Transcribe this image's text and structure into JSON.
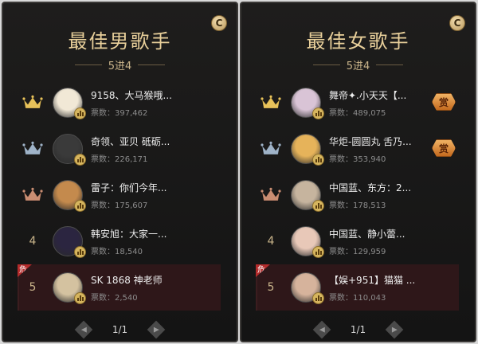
{
  "panels": [
    {
      "title": "最佳男歌手",
      "subtitle": "5进4",
      "page": "1/1",
      "rows": [
        {
          "rank": "",
          "crown": "gold",
          "name": "9158、大马猴哦...",
          "votes": "票数：397,462",
          "danger": false,
          "reward": false
        },
        {
          "rank": "",
          "crown": "silver",
          "name": "奇领、亚贝 砥砺...",
          "votes": "票数：226,171",
          "danger": false,
          "reward": false
        },
        {
          "rank": "",
          "crown": "bronze",
          "name": "雷子：你们今年...",
          "votes": "票数：175,607",
          "danger": false,
          "reward": false
        },
        {
          "rank": "4",
          "crown": "",
          "name": "韩安旭：大家一...",
          "votes": "票数：18,540",
          "danger": false,
          "reward": false
        },
        {
          "rank": "5",
          "crown": "",
          "name": "SK 1868 神老师",
          "votes": "票数：2,540",
          "danger": true,
          "reward": false
        }
      ]
    },
    {
      "title": "最佳女歌手",
      "subtitle": "5进4",
      "page": "1/1",
      "rows": [
        {
          "rank": "",
          "crown": "gold",
          "name": "舞帝✦.小天天【...",
          "votes": "票数：489,075",
          "danger": false,
          "reward": true
        },
        {
          "rank": "",
          "crown": "silver",
          "name": "华炬-圆圆丸 舌乃...",
          "votes": "票数：353,940",
          "danger": false,
          "reward": true
        },
        {
          "rank": "",
          "crown": "bronze",
          "name": "中国蓝、东方：2...",
          "votes": "票数：178,513",
          "danger": false,
          "reward": false
        },
        {
          "rank": "4",
          "crown": "",
          "name": "中国蓝、静小蕾...",
          "votes": "票数：129,959",
          "danger": false,
          "reward": false
        },
        {
          "rank": "5",
          "crown": "",
          "name": "【娱+951】猫猫 ...",
          "votes": "票数：110,043",
          "danger": true,
          "reward": false
        }
      ]
    }
  ],
  "labels": {
    "corner_badge": "C",
    "danger_tag": "危",
    "reward_tag": "赏",
    "prev": "◀",
    "next": "▶"
  },
  "colors": {
    "gold": "#e8c25a",
    "silver": "#9fb3c8",
    "bronze": "#c98d72",
    "accent": "#e8cf9a"
  },
  "avatars": [
    [
      "#f1e8d6",
      "#3a3a3a",
      "#c48a4d",
      "#2b2540",
      "#d4c2a0"
    ],
    [
      "#d9c4d6",
      "#e6b35a",
      "#c6b49e",
      "#e8c8b8",
      "#d6b39c"
    ]
  ]
}
